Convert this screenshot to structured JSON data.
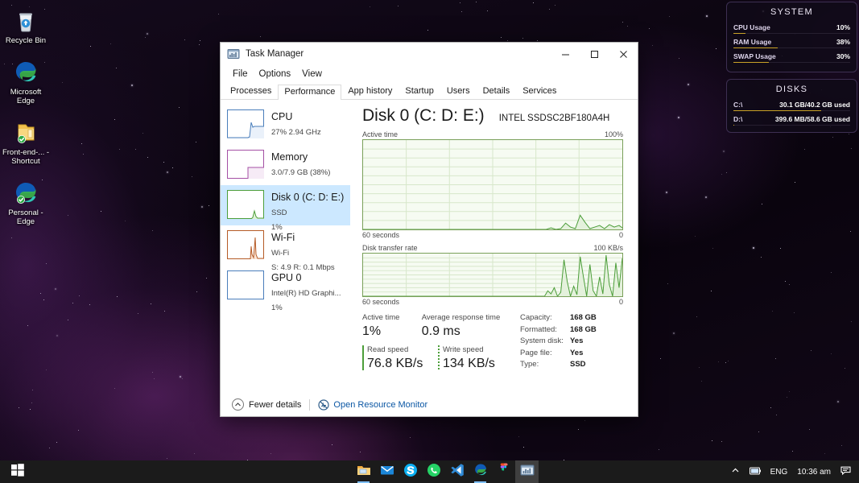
{
  "desktop": {
    "icons": [
      {
        "name": "Recycle Bin",
        "icon": "recycle-bin-icon"
      },
      {
        "name": "Microsoft Edge",
        "icon": "microsoft-edge-icon"
      },
      {
        "name": "Front-end-... - Shortcut",
        "icon": "folder-shortcut-icon"
      },
      {
        "name": "Personal - Edge",
        "icon": "edge-shortcut-icon"
      }
    ]
  },
  "widgets": [
    {
      "title": "SYSTEM",
      "rows": [
        {
          "key": "CPU Usage",
          "value": "10%",
          "percent": 10
        },
        {
          "key": "RAM Usage",
          "value": "38%",
          "percent": 38
        },
        {
          "key": "SWAP Usage",
          "value": "30%",
          "percent": 30
        }
      ]
    },
    {
      "title": "DISKS",
      "rows": [
        {
          "key": "C:\\",
          "value": "30.1 GB/40.2 GB used",
          "percent": 75
        },
        {
          "key": "D:\\",
          "value": "399.6 MB/58.6 GB used",
          "percent": 1
        }
      ]
    }
  ],
  "taskbar": {
    "start_icon": "windows-start-icon",
    "apps": [
      {
        "name": "File Explorer",
        "icon": "file-explorer-icon",
        "active": false,
        "running": true
      },
      {
        "name": "Mail",
        "icon": "mail-icon",
        "active": false,
        "running": false
      },
      {
        "name": "Skype",
        "icon": "skype-icon",
        "active": false,
        "running": false
      },
      {
        "name": "WhatsApp",
        "icon": "whatsapp-icon",
        "active": false,
        "running": false
      },
      {
        "name": "Visual Studio Code",
        "icon": "vscode-icon",
        "active": false,
        "running": false
      },
      {
        "name": "Microsoft Edge",
        "icon": "edge-icon",
        "active": false,
        "running": true
      },
      {
        "name": "Figma",
        "icon": "figma-icon",
        "active": false,
        "running": false
      },
      {
        "name": "Task Manager",
        "icon": "task-manager-icon",
        "active": true,
        "running": false
      }
    ],
    "tray": {
      "overflow_icon": "chevron-up-icon",
      "battery_icon": "battery-icon",
      "language": "ENG",
      "clock": "10:36 am",
      "action_center_icon": "action-center-icon"
    }
  },
  "task_manager": {
    "title": "Task Manager",
    "title_icon": "task-manager-icon",
    "window_buttons": {
      "minimize": "minimize-icon",
      "maximize": "maximize-icon",
      "close": "close-icon"
    },
    "menu": [
      "File",
      "Options",
      "View"
    ],
    "tabs": [
      {
        "label": "Processes",
        "selected": false
      },
      {
        "label": "Performance",
        "selected": true
      },
      {
        "label": "App history",
        "selected": false
      },
      {
        "label": "Startup",
        "selected": false
      },
      {
        "label": "Users",
        "selected": false
      },
      {
        "label": "Details",
        "selected": false
      },
      {
        "label": "Services",
        "selected": false
      }
    ],
    "sidebar": [
      {
        "name": "CPU",
        "sub1": "27% 2.94 GHz",
        "sub2": "",
        "selected": false,
        "accent": "#4a7ebb",
        "fill": "#eaf1fa"
      },
      {
        "name": "Memory",
        "sub1": "3.0/7.9 GB (38%)",
        "sub2": "",
        "selected": false,
        "accent": "#a44fa4",
        "fill": "#f6ebf6"
      },
      {
        "name": "Disk 0 (C: D: E:)",
        "sub1": "SSD",
        "sub2": "1%",
        "selected": true,
        "accent": "#4c9e3a",
        "fill": "#eef7e9"
      },
      {
        "name": "Wi-Fi",
        "sub1": "Wi-Fi",
        "sub2": "S: 4.9 R: 0.1 Mbps",
        "selected": false,
        "accent": "#b55a26",
        "fill": "#fbf0e8"
      },
      {
        "name": "GPU 0",
        "sub1": "Intel(R) HD Graphi...",
        "sub2": "1%",
        "selected": false,
        "accent": "#4a7ebb",
        "fill": "#eaf1fa"
      }
    ],
    "detail": {
      "title": "Disk 0 (C: D: E:)",
      "model": "INTEL SSDSC2BF180A4H",
      "graph1": {
        "label": "Active time",
        "max": "100%",
        "left_foot": "60 seconds",
        "right_foot": "0"
      },
      "graph2": {
        "label": "Disk transfer rate",
        "max": "100 KB/s",
        "left_foot": "60 seconds",
        "right_foot": "0"
      },
      "stats": {
        "active_time_label": "Active time",
        "active_time_value": "1%",
        "avg_response_label": "Average response time",
        "avg_response_value": "0.9 ms",
        "read_speed_label": "Read speed",
        "read_speed_value": "76.8 KB/s",
        "write_speed_label": "Write speed",
        "write_speed_value": "134 KB/s",
        "details": [
          {
            "key": "Capacity:",
            "value": "168 GB"
          },
          {
            "key": "Formatted:",
            "value": "168 GB"
          },
          {
            "key": "System disk:",
            "value": "Yes"
          },
          {
            "key": "Page file:",
            "value": "Yes"
          },
          {
            "key": "Type:",
            "value": "SSD"
          }
        ]
      }
    },
    "footer": {
      "fewer_details": "Fewer details",
      "fewer_details_icon": "chevron-up-icon",
      "resource_monitor": "Open Resource Monitor",
      "resource_monitor_icon": "resource-monitor-icon"
    }
  },
  "chart_data": [
    {
      "type": "area",
      "title": "Active time",
      "ylabel": "",
      "xlabel": "60 seconds",
      "ylim": [
        0,
        100
      ],
      "yunit": "%",
      "grid": true,
      "x": [
        0,
        2,
        4,
        6,
        8,
        10,
        12,
        14,
        16,
        18,
        20,
        22,
        24,
        26,
        28,
        30,
        32,
        34,
        36,
        38,
        40,
        42,
        44,
        46,
        48,
        50,
        52,
        54,
        56,
        58,
        60
      ],
      "values": [
        0,
        0,
        0,
        0,
        0,
        0,
        0,
        0,
        0,
        0,
        0,
        0,
        0,
        0,
        0,
        0,
        0,
        0,
        0,
        0,
        0,
        1,
        2,
        1,
        0,
        6,
        15,
        4,
        0,
        2,
        3
      ]
    },
    {
      "type": "area",
      "title": "Disk transfer rate",
      "ylabel": "",
      "xlabel": "60 seconds",
      "ylim": [
        0,
        100
      ],
      "yunit": "KB/s",
      "grid": true,
      "x": [
        0,
        2,
        4,
        6,
        8,
        10,
        12,
        14,
        16,
        18,
        20,
        22,
        24,
        26,
        28,
        30,
        32,
        34,
        36,
        38,
        40,
        42,
        44,
        46,
        48,
        50,
        52,
        54,
        56,
        58,
        60
      ],
      "values": [
        0,
        0,
        0,
        0,
        0,
        0,
        0,
        0,
        0,
        0,
        0,
        0,
        0,
        0,
        0,
        0,
        0,
        0,
        0,
        0,
        0,
        12,
        30,
        8,
        70,
        3,
        90,
        5,
        100,
        10,
        80
      ]
    }
  ]
}
